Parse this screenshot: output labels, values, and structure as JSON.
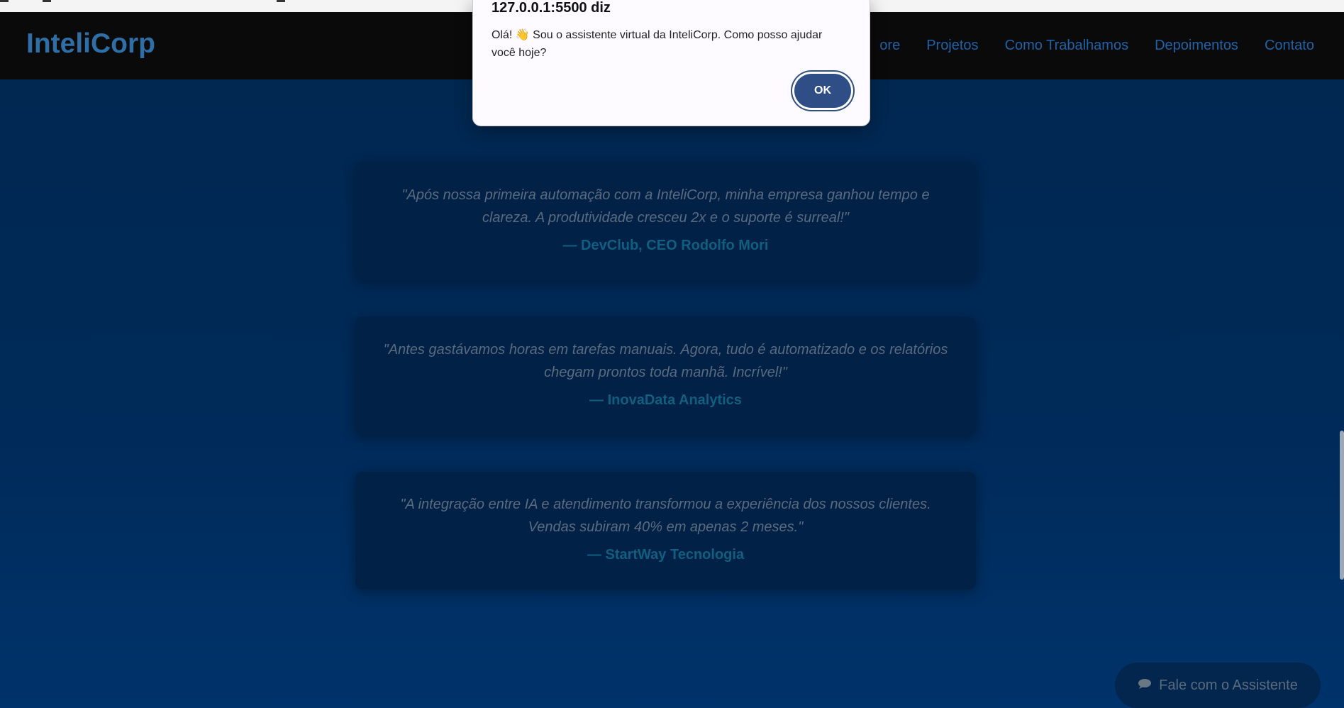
{
  "dialog": {
    "title": "127.0.0.1:5500 diz",
    "message": "Olá! 👋 Sou o assistente virtual da InteliCorp. Como posso ajudar você hoje?",
    "ok_label": "OK"
  },
  "navbar": {
    "logo": "InteliCorp",
    "links": [
      "ore",
      "Projetos",
      "Como Trabalhamos",
      "Depoimentos",
      "Contato"
    ]
  },
  "testimonials": [
    {
      "quote": "\"Após nossa primeira automação com a InteliCorp, minha empresa ganhou tempo e clareza. A produtividade cresceu 2x e o suporte é surreal!\"",
      "author": "— DevClub, CEO Rodolfo Mori"
    },
    {
      "quote": "\"Antes gastávamos horas em tarefas manuais. Agora, tudo é automatizado e os relatórios chegam prontos toda manhã. Incrível!\"",
      "author": "— InovaData Analytics"
    },
    {
      "quote": "\"A integração entre IA e atendimento transformou a experiência dos nossos clientes. Vendas subiram 40% em apenas 2 meses.\"",
      "author": "— StartWay Tecnologia"
    }
  ],
  "chat_button": {
    "icon": "speech-bubble-icon",
    "label": "Fale com o Assistente"
  },
  "colors": {
    "navbar_bg": "#0a0a0a",
    "logo": "#2f6fa8",
    "nav_link": "#1e62a8",
    "page_bg": "#00254d",
    "author": "#0f5f80",
    "ok_button": "#2f4e86"
  }
}
